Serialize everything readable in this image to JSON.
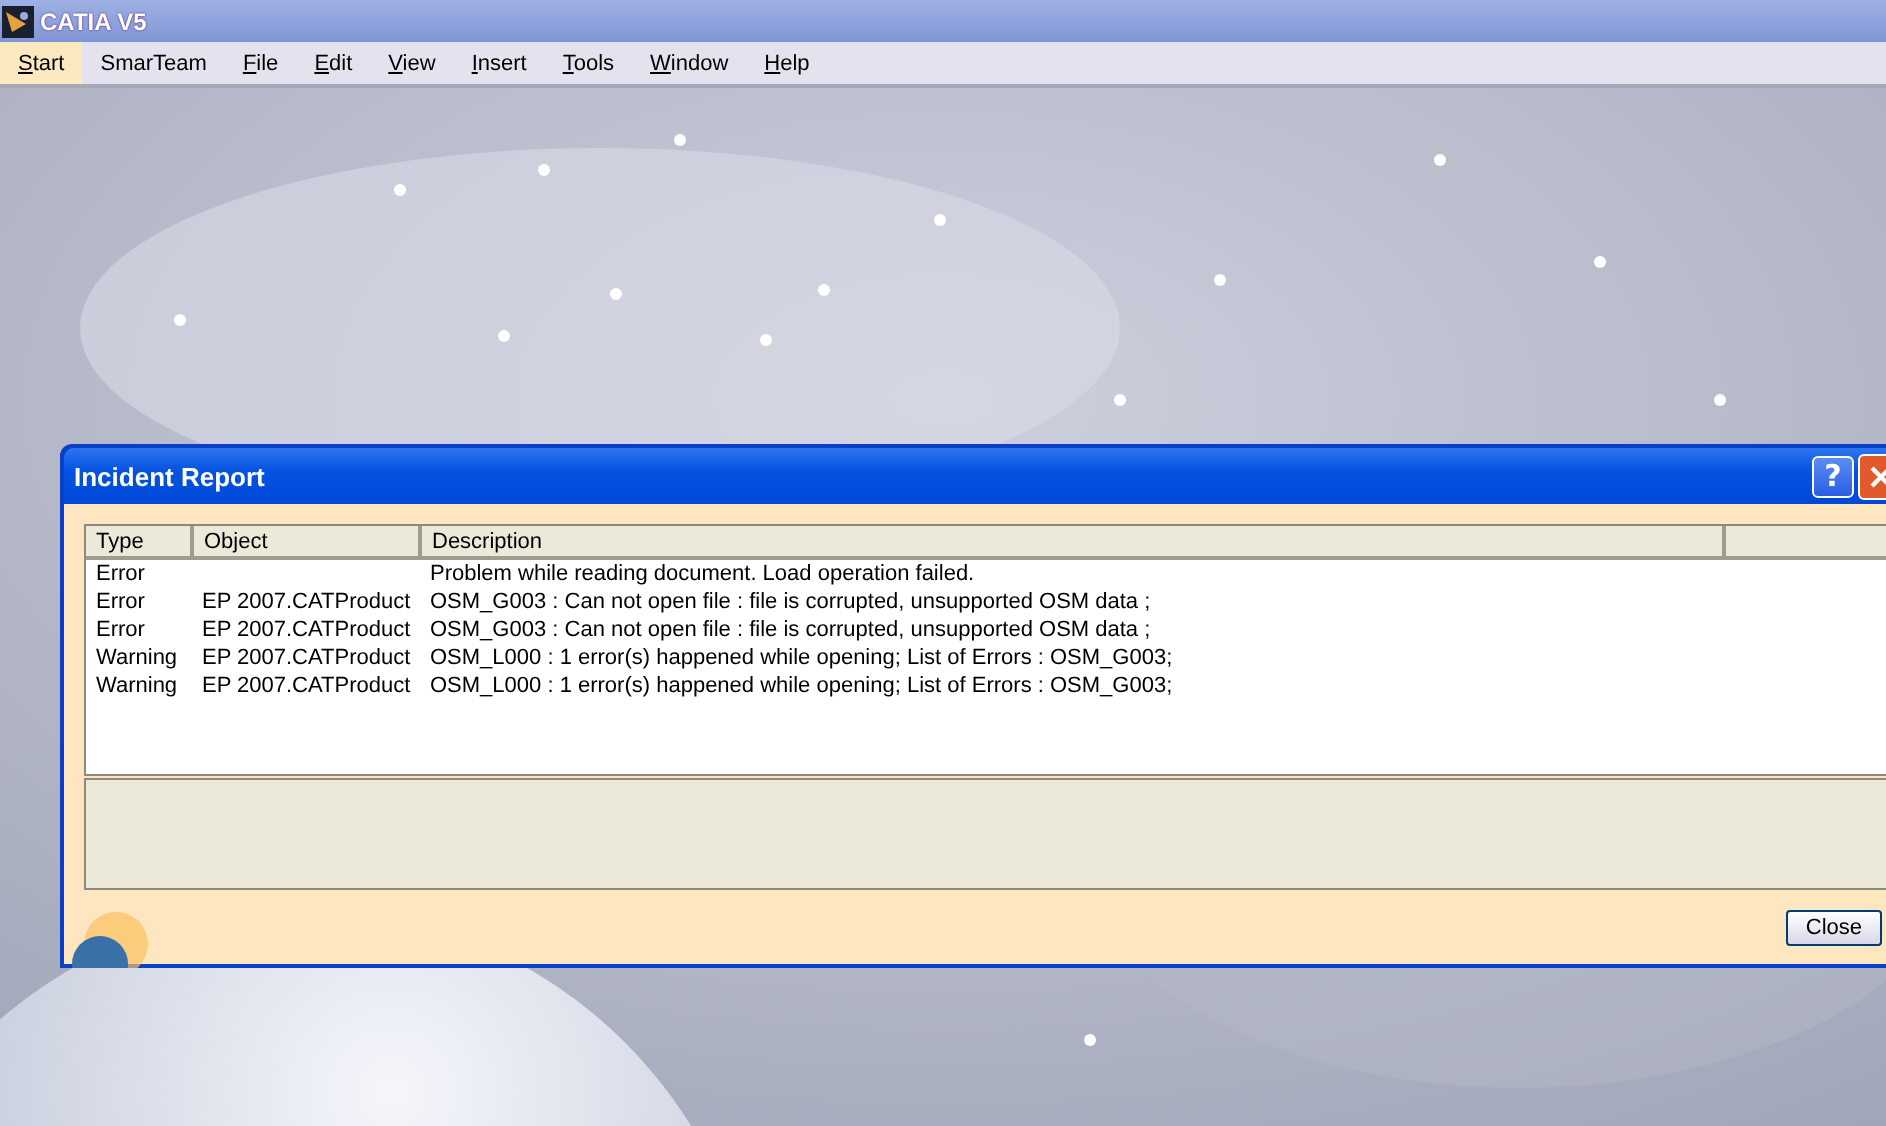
{
  "window": {
    "title": "CATIA V5"
  },
  "menu": [
    {
      "label": "Start",
      "underlined": true,
      "selected": true
    },
    {
      "label": "SmarTeam",
      "underlined": false,
      "selected": false
    },
    {
      "label": "File",
      "underlined": true,
      "selected": false
    },
    {
      "label": "Edit",
      "underlined": true,
      "selected": false
    },
    {
      "label": "View",
      "underlined": true,
      "selected": false
    },
    {
      "label": "Insert",
      "underlined": true,
      "selected": false
    },
    {
      "label": "Tools",
      "underlined": true,
      "selected": false
    },
    {
      "label": "Window",
      "underlined": true,
      "selected": false
    },
    {
      "label": "Help",
      "underlined": true,
      "selected": false
    }
  ],
  "dialog": {
    "title": "Incident Report",
    "help_button": "?",
    "table": {
      "columns": [
        "Type",
        "Object",
        "Description"
      ],
      "rows": [
        {
          "type": "Error",
          "object": "",
          "description": "Problem while reading document. Load operation failed."
        },
        {
          "type": "Error",
          "object": "EP 2007.CATProduct",
          "description": "OSM_G003 : Can not open file : file is corrupted, unsupported OSM data ;"
        },
        {
          "type": "Error",
          "object": "EP 2007.CATProduct",
          "description": "OSM_G003 : Can not open file : file is corrupted, unsupported OSM data ;"
        },
        {
          "type": "Warning",
          "object": "EP 2007.CATProduct",
          "description": "OSM_L000 : 1 error(s) happened while opening; List of Errors  : OSM_G003;"
        },
        {
          "type": "Warning",
          "object": "EP 2007.CATProduct",
          "description": "OSM_L000 : 1 error(s) happened while opening; List of Errors  : OSM_G003;"
        }
      ]
    },
    "buttons": [
      "Close"
    ]
  }
}
